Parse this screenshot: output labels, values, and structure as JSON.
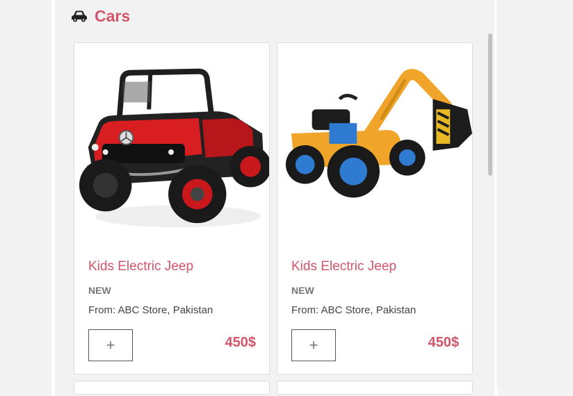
{
  "section": {
    "title": "Cars",
    "icon": "car-icon"
  },
  "products": [
    {
      "name": "Kids Electric Jeep",
      "condition": "NEW",
      "from": "From: ABC Store, Pakistan",
      "add_label": "+",
      "price": "450$",
      "image": "red-electric-jeep"
    },
    {
      "name": "Kids Electric Jeep",
      "condition": "NEW",
      "from": "From: ABC Store, Pakistan",
      "add_label": "+",
      "price": "450$",
      "image": "yellow-excavator-ride-on"
    }
  ],
  "colors": {
    "accent": "#d4546a",
    "text": "#444444",
    "muted": "#777777"
  }
}
